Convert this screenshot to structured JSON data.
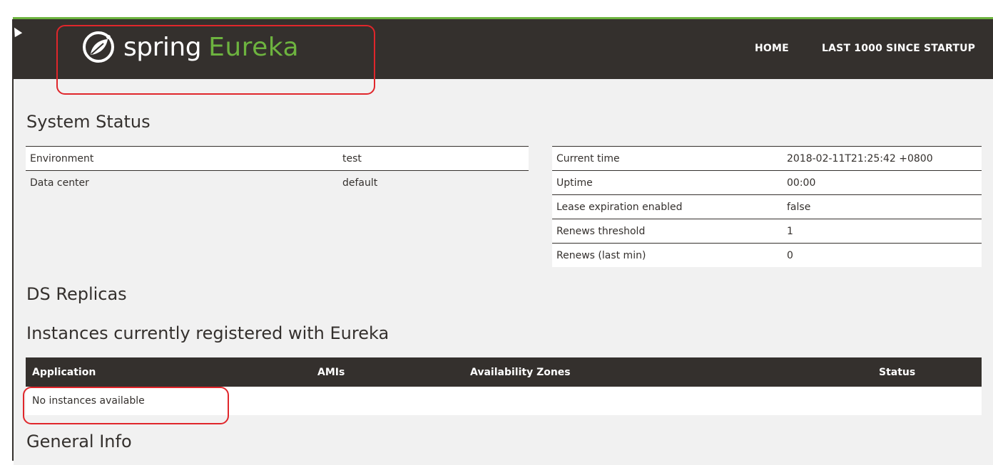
{
  "brand": {
    "spring": "spring",
    "eureka": "Eureka"
  },
  "nav": {
    "home": "HOME",
    "last": "LAST 1000 SINCE STARTUP"
  },
  "headings": {
    "system_status": "System Status",
    "ds_replicas": "DS Replicas",
    "instances": "Instances currently registered with Eureka",
    "general_info": "General Info"
  },
  "status_left": [
    {
      "key": "Environment",
      "value": "test"
    },
    {
      "key": "Data center",
      "value": "default"
    }
  ],
  "status_right": [
    {
      "key": "Current time",
      "value": "2018-02-11T21:25:42 +0800"
    },
    {
      "key": "Uptime",
      "value": "00:00"
    },
    {
      "key": "Lease expiration enabled",
      "value": "false"
    },
    {
      "key": "Renews threshold",
      "value": "1"
    },
    {
      "key": "Renews (last min)",
      "value": "0"
    }
  ],
  "instances_table": {
    "columns": [
      "Application",
      "AMIs",
      "Availability Zones",
      "Status"
    ],
    "empty_message": "No instances available"
  },
  "colors": {
    "navbar": "#34302d",
    "accent": "#6db33f",
    "highlight": "#e0262b",
    "page_bg": "#f1f1f1"
  }
}
